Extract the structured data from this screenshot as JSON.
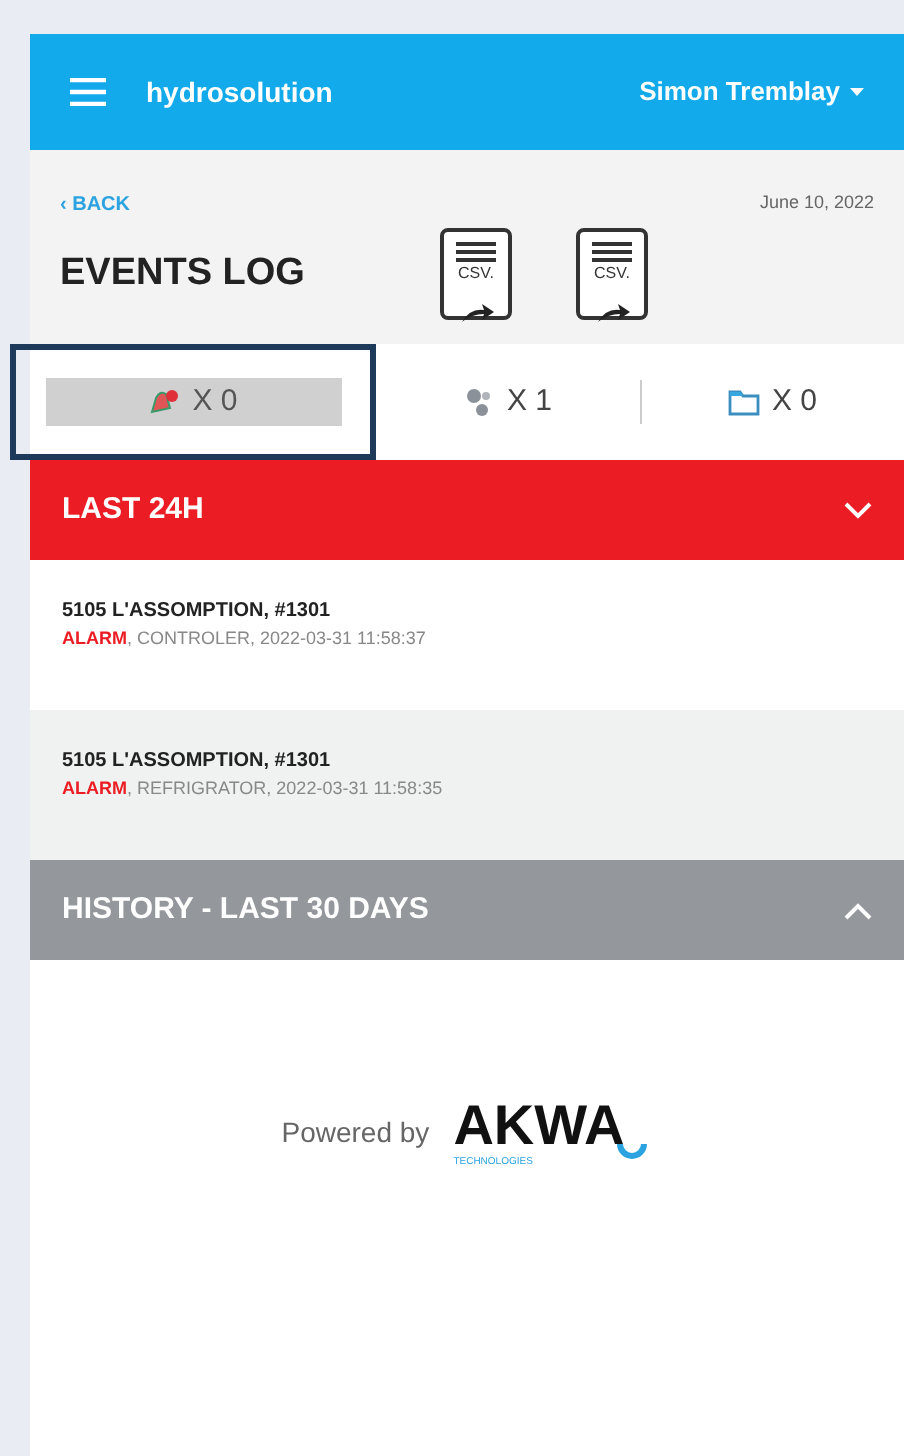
{
  "header": {
    "app_name": "hydrosolution",
    "user": "Simon Tremblay"
  },
  "back": "‹ BACK",
  "date": "June 10, 2022",
  "title": "EVENTS LOG",
  "exports": [
    {
      "label": "CSV."
    },
    {
      "label": "CSV."
    }
  ],
  "filters": [
    {
      "kind": "alarm",
      "count": "X 0",
      "selected": true
    },
    {
      "kind": "sensor",
      "count": "X 1",
      "selected": false
    },
    {
      "kind": "folder",
      "count": "X 0",
      "selected": false
    }
  ],
  "sections": [
    {
      "title": "LAST 24H",
      "expanded": true,
      "color": "#ec1c24",
      "events": [
        {
          "location": "5105 L'ASSOMPTION, #1301",
          "type": "ALARM",
          "detail": ", CONTROLER, 2022-03-31 11:58:37"
        },
        {
          "location": "5105 L'ASSOMPTION, #1301",
          "type": "ALARM",
          "detail": ", REFRIGRATOR, 2022-03-31 11:58:35"
        }
      ]
    },
    {
      "title": "HISTORY - LAST 30 DAYS",
      "expanded": false,
      "color": "#94979b"
    }
  ],
  "footer": {
    "powered": "Powered by",
    "logo": "AKWA",
    "logo_sub": "TECHNOLOGIES"
  }
}
